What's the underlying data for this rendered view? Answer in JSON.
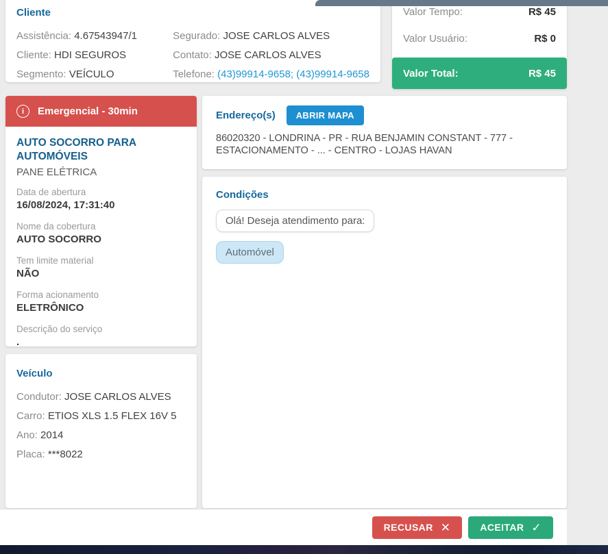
{
  "client_card": {
    "title": "Cliente",
    "fields_left": [
      {
        "label": "Assistência:",
        "value": "4.67543947/1"
      },
      {
        "label": "Cliente:",
        "value": "HDI SEGUROS"
      },
      {
        "label": "Segmento:",
        "value": "VEÍCULO"
      }
    ],
    "fields_right": [
      {
        "label": "Segurado:",
        "value": "JOSE CARLOS ALVES"
      },
      {
        "label": "Contato:",
        "value": "JOSE CARLOS ALVES"
      },
      {
        "label": "Telefone:",
        "value": "(43)99914-9658; (43)99914-9658"
      }
    ]
  },
  "totals_card": {
    "rows": [
      {
        "label": "Valor Tempo:",
        "value": "R$ 45"
      },
      {
        "label": "Valor Usuário:",
        "value": "R$ 0"
      }
    ],
    "total": {
      "label": "Valor Total:",
      "value": "R$ 45"
    }
  },
  "service_card": {
    "header": "Emergencial - 30min",
    "info_icon_glyph": "i",
    "service_name": "AUTO SOCORRO PARA AUTOMÓVEIS",
    "service_sub": "PANE ELÉTRICA",
    "details": [
      {
        "label": "Data de abertura",
        "value": "16/08/2024, 17:31:40"
      },
      {
        "label": "Nome da cobertura",
        "value": "AUTO SOCORRO"
      },
      {
        "label": "Tem limite material",
        "value": "NÃO"
      },
      {
        "label": "Forma acionamento",
        "value": "ELETRÔNICO"
      },
      {
        "label": "Descrição do serviço",
        "value": "."
      }
    ]
  },
  "vehicle_card": {
    "title": "Veículo",
    "fields": [
      {
        "label": "Condutor:",
        "value": "JOSE CARLOS ALVES"
      },
      {
        "label": "Carro:",
        "value": "ETIOS XLS 1.5 FLEX 16V 5"
      },
      {
        "label": "Ano:",
        "value": "2014"
      },
      {
        "label": "Placa:",
        "value": "***8022"
      }
    ]
  },
  "address_card": {
    "title": "Endereço(s)",
    "map_button_label": "ABRIR MAPA",
    "address": "86020320 - LONDRINA - PR - RUA BENJAMIN CONSTANT - 777 - ESTACIONAMENTO - ... - CENTRO - LOJAS HAVAN"
  },
  "conditions_card": {
    "title": "Condições",
    "messages": [
      {
        "text": "Olá! Deseja atendimento para:"
      },
      {
        "text": "Automóvel"
      }
    ]
  },
  "footer": {
    "reject_label": "RECUSAR",
    "reject_icon_glyph": "✕",
    "accept_label": "ACEITAR",
    "accept_icon_glyph": "✓"
  },
  "colors": {
    "heading_blue": "#16689c",
    "link_blue": "#1e96d4",
    "button_blue": "#1e8fd0",
    "alert_red": "#d6514d",
    "success_green": "#2fae7d",
    "accept_green": "#2ba97a",
    "top_bar_slate": "#66788a",
    "background_gray": "#ececec",
    "bottom_bar_navy": "#18223c"
  }
}
